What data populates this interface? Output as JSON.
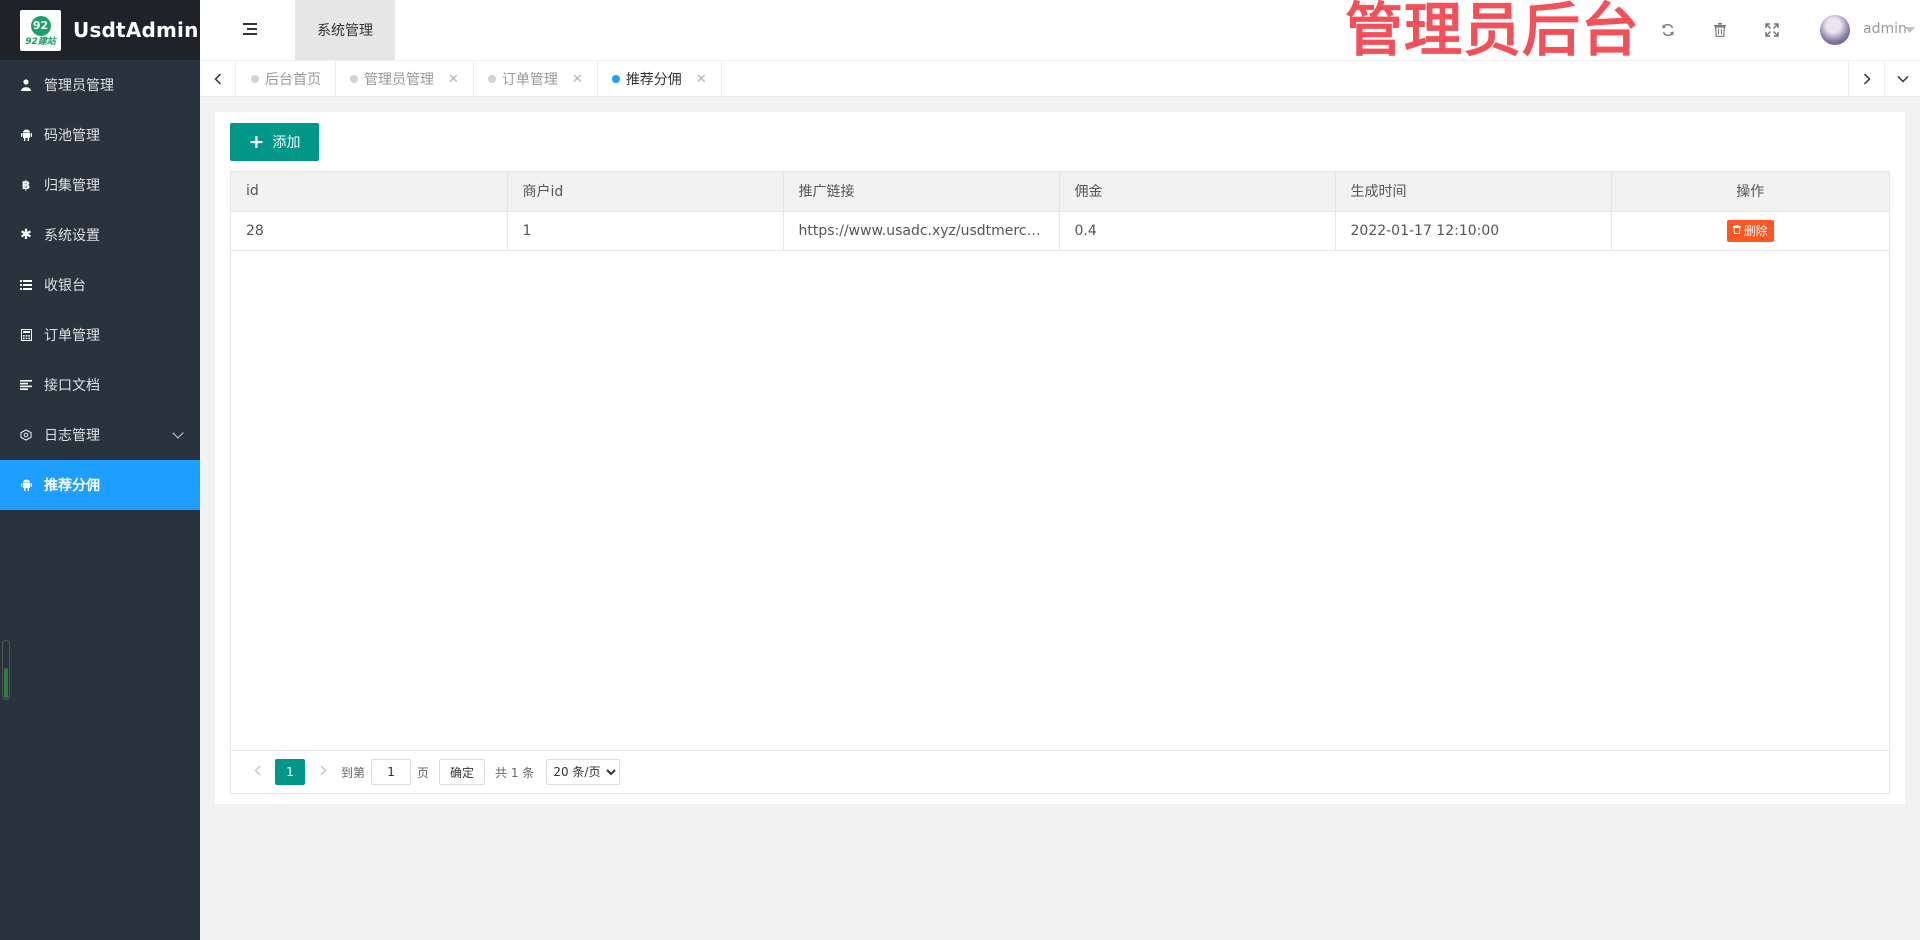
{
  "app": {
    "title": "UsdtAdmin",
    "logo_text": "92建站",
    "logo_mark": "92"
  },
  "sidebar": {
    "items": [
      {
        "label": "管理员管理",
        "icon": "user-icon"
      },
      {
        "label": "码池管理",
        "icon": "android-icon"
      },
      {
        "label": "归集管理",
        "icon": "bitcoin-icon"
      },
      {
        "label": "系统设置",
        "icon": "asterisk-icon"
      },
      {
        "label": "收银台",
        "icon": "list-icon"
      },
      {
        "label": "订单管理",
        "icon": "calculator-icon"
      },
      {
        "label": "接口文档",
        "icon": "align-left-icon"
      },
      {
        "label": "日志管理",
        "icon": "cogs-icon"
      },
      {
        "label": "推荐分佣",
        "icon": "android-icon",
        "active": true
      }
    ]
  },
  "header": {
    "nav_tab": "系统管理",
    "banner": "管理员后台",
    "username": "admin"
  },
  "tabs": [
    {
      "label": "后台首页"
    },
    {
      "label": "管理员管理",
      "close": "✕"
    },
    {
      "label": "订单管理",
      "close": "✕"
    },
    {
      "label": "推荐分佣",
      "close": "✕",
      "active": true
    }
  ],
  "toolbar": {
    "add_label": "添加",
    "add_icon": "+"
  },
  "table": {
    "columns": [
      "id",
      "商户id",
      "推广链接",
      "佣金",
      "生成时间",
      "操作"
    ],
    "rows": [
      {
        "id": "28",
        "merchant_id": "1",
        "link": "https://www.usadc.xyz/usdtmerchant/...",
        "commission": "0.4",
        "created": "2022-01-17 12:10:00",
        "action": "删除"
      }
    ]
  },
  "pager": {
    "current": "1",
    "goto_prefix": "到第",
    "goto_value": "1",
    "goto_suffix": "页",
    "confirm": "确定",
    "total": "共 1 条",
    "page_size": "20 条/页"
  },
  "colors": {
    "sidebar_bg": "#28333e",
    "logo_bg": "#20222a",
    "active_menu": "#1e9fff",
    "primary": "#009688",
    "danger": "#ff5722",
    "banner": "#f3505a"
  }
}
